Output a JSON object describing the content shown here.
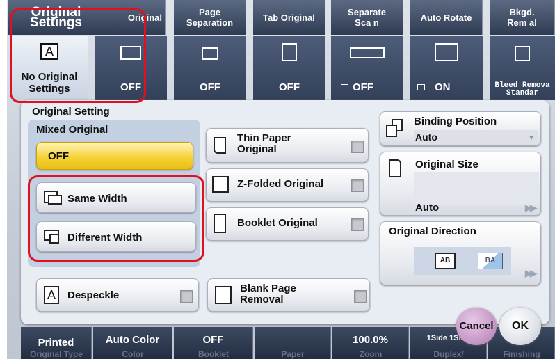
{
  "header": {
    "title": "Original Settings",
    "cols": [
      "Original",
      "Page Separation",
      "Tab Original",
      "Separate Sca n",
      "Auto Rotate",
      "Bkgd. Rem al"
    ]
  },
  "tabs": [
    {
      "label": "No Original Settings",
      "value": ""
    },
    {
      "label": "",
      "value": "OFF"
    },
    {
      "label": "",
      "value": "OFF"
    },
    {
      "label": "",
      "value": "OFF"
    },
    {
      "label": "",
      "value": "OFF"
    },
    {
      "label": "",
      "value": "ON"
    },
    {
      "label": "Bleed Remova Standar",
      "value": ""
    }
  ],
  "panel": {
    "section_title": "Original Setting",
    "mixed_label": "Mixed Original",
    "mixed_value": "OFF",
    "same_width": "Same Width",
    "different_width": "Different Width",
    "thin_paper": "Thin Paper Original",
    "z_folded": "Z-Folded Original",
    "booklet": "Booklet Original",
    "despeckle": "Despeckle",
    "blank_page": "Blank Page Removal",
    "binding_position_label": "Binding Position",
    "binding_position_value": "Auto",
    "original_size_label": "Original Size",
    "original_size_value": "Auto",
    "original_direction_label": "Original Direction",
    "dir_icon_1": "AB",
    "dir_icon_2": "BA"
  },
  "footer": {
    "cancel": "Cancel",
    "ok": "OK",
    "items": [
      "Printed",
      "Auto Color",
      "OFF",
      "",
      "100.0%",
      "1Side\n1Side",
      ""
    ],
    "labels": [
      "Original Type",
      "Color",
      "Booklet",
      "Paper",
      "Zoom",
      "Duplex/",
      "Finishing"
    ]
  },
  "colors": {
    "highlight": "#e01020",
    "accent": "#f5d030",
    "cancel_circle": "#c89ac8"
  }
}
